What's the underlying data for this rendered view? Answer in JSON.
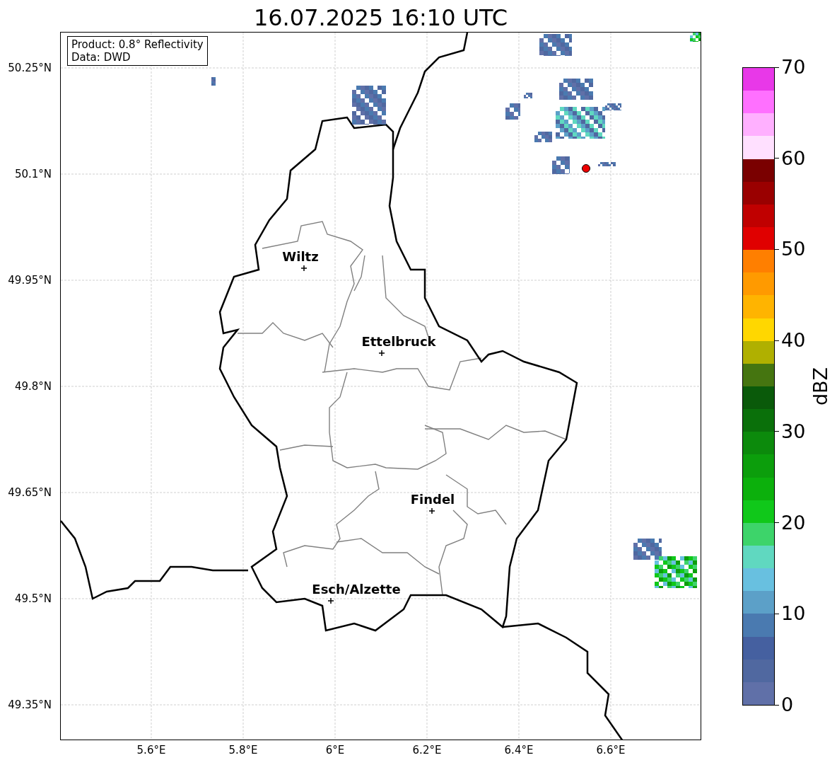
{
  "title": "16.07.2025 16:10 UTC",
  "legend": [
    "Product: 0.8° Reflectivity",
    "Data: DWD"
  ],
  "lat_ticks": [
    "50.25°N",
    "50.1°N",
    "49.95°N",
    "49.8°N",
    "49.65°N",
    "49.5°N",
    "49.35°N"
  ],
  "lon_ticks": [
    "5.6°E",
    "5.8°E",
    "6°E",
    "6.2°E",
    "6.4°E",
    "6.6°E"
  ],
  "cities": [
    {
      "name": "Wiltz"
    },
    {
      "name": "Ettelbruck"
    },
    {
      "name": "Findel"
    },
    {
      "name": "Esch/Alzette"
    }
  ],
  "colorbar": {
    "label": "dBZ",
    "ticks": [
      "70",
      "60",
      "50",
      "40",
      "30",
      "20",
      "10",
      "0"
    ],
    "segments": [
      {
        "color": "#6070a8"
      },
      {
        "color": "#5068a0"
      },
      {
        "color": "#4560a0"
      },
      {
        "color": "#4a7ab0"
      },
      {
        "color": "#5ca0c8"
      },
      {
        "color": "#68c0e0"
      },
      {
        "color": "#60d8c0"
      },
      {
        "color": "#3dd46a"
      },
      {
        "color": "#10c81a"
      },
      {
        "color": "#0cb00c"
      },
      {
        "color": "#0c9e0c"
      },
      {
        "color": "#0c8a0c"
      },
      {
        "color": "#0a700a"
      },
      {
        "color": "#0a5a0a"
      },
      {
        "color": "#457510"
      },
      {
        "color": "#b0b000"
      },
      {
        "color": "#ffd700"
      },
      {
        "color": "#ffb400"
      },
      {
        "color": "#ff9a00"
      },
      {
        "color": "#ff7f00"
      },
      {
        "color": "#e00000"
      },
      {
        "color": "#c00000"
      },
      {
        "color": "#9a0000"
      },
      {
        "color": "#7a0000"
      },
      {
        "color": "#ffe0ff"
      },
      {
        "color": "#ffb0ff"
      },
      {
        "color": "#ff70ff"
      },
      {
        "color": "#e838e8"
      }
    ]
  }
}
